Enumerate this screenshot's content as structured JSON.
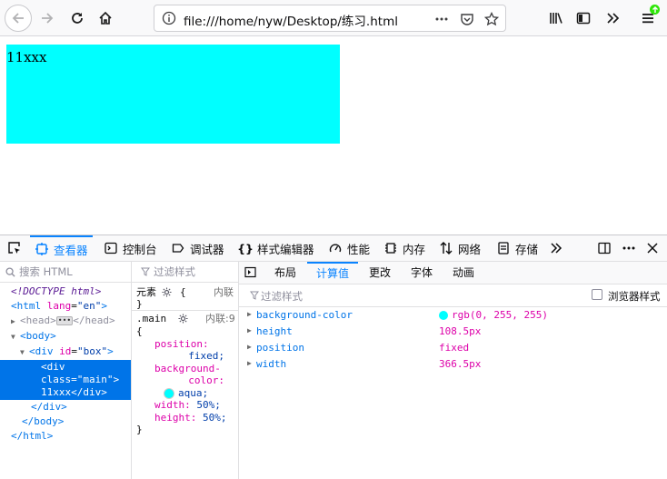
{
  "browser": {
    "url": "file:///home/nyw/Desktop/练习.html",
    "icons": [
      "back-icon",
      "forward-icon",
      "reload-icon",
      "home-icon",
      "info-icon",
      "page-actions-icon",
      "pocket-icon",
      "bookmark-star-icon",
      "library-icon",
      "sidebar-icon",
      "overflow-icon",
      "menu-icon"
    ],
    "update_badge_color": "#30e60b"
  },
  "page": {
    "box_text": "11xxx",
    "box_color": "#00ffff"
  },
  "devtools": {
    "tabs": [
      {
        "label": "查看器",
        "icon": "inspector-icon",
        "active": true
      },
      {
        "label": "控制台",
        "icon": "console-icon"
      },
      {
        "label": "调试器",
        "icon": "debugger-icon"
      },
      {
        "label": "样式编辑器",
        "icon": "style-editor-icon"
      },
      {
        "label": "性能",
        "icon": "performance-icon"
      },
      {
        "label": "内存",
        "icon": "memory-icon"
      },
      {
        "label": "网络",
        "icon": "network-icon"
      },
      {
        "label": "存储",
        "icon": "storage-icon"
      }
    ],
    "markup": {
      "search_placeholder": "搜索 HTML",
      "doctype": "<!DOCTYPE html>",
      "html_open_tag": "<html",
      "html_lang_attr": "lang",
      "html_lang_val": "\"en\"",
      "head_label": "<head>",
      "head_close": "</head>",
      "body_open": "<body>",
      "div_tag": "<div",
      "div_id_attr": "id",
      "div_id_val": "\"box\"",
      "sel_line1": "<div",
      "sel_line2_attr": "class",
      "sel_line2_val": "\"main\"",
      "sel_line3": "11xxx</div>",
      "div_close": "</div>",
      "body_close": "</body>",
      "html_close": "</html>"
    },
    "rules": {
      "filter_placeholder": "过滤样式",
      "element_label": "元素",
      "element_open": "{",
      "element_close": "}",
      "inline_label": "内联",
      "selector": ".main",
      "source": "内联:9",
      "open_brace": "{",
      "close_brace": "}",
      "declarations": [
        {
          "prop": "position:",
          "val": "fixed;"
        },
        {
          "prop": "background-",
          "prop2": "color:",
          "val": "aqua;"
        },
        {
          "prop": "width:",
          "val": "50%;"
        },
        {
          "prop": "height:",
          "val": "50%;"
        }
      ]
    },
    "computed": {
      "subtabs": [
        "布局",
        "计算值",
        "更改",
        "字体",
        "动画"
      ],
      "active_subtab": "计算值",
      "filter_placeholder": "过滤样式",
      "browser_styles_label": "浏览器样式",
      "properties": [
        {
          "name": "background-color",
          "value": "rgb(0, 255, 255)",
          "swatch": "#00ffff"
        },
        {
          "name": "height",
          "value": "108.5px"
        },
        {
          "name": "position",
          "value": "fixed"
        },
        {
          "name": "width",
          "value": "366.5px"
        }
      ]
    }
  }
}
